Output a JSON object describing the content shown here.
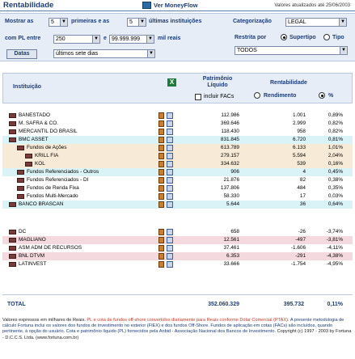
{
  "header": {
    "title": "Rentabilidade",
    "link": "Ver MoneyFlow",
    "updated": "Valores atualizados até 25/06/2003"
  },
  "filters": {
    "show_label": "Mostrar as",
    "first_value": "5",
    "first_label": "primeiras e as",
    "last_value": "5",
    "last_label": "últimas instituições",
    "category_label": "Categorização",
    "category_value": "LEGAL",
    "pl_label": "com PL entre",
    "pl_min": "250",
    "and_label": "e",
    "pl_max": "99.999.999",
    "thousands_label": "mil reais",
    "restrict_label": "Restrita por",
    "supertipo_label": "Supertipo",
    "tipo_label": "Tipo",
    "restrict_value": "TODOS",
    "dates_button": "Datas",
    "period_value": "últimos sete dias"
  },
  "table": {
    "col_institution": "Instituição",
    "col_patrimony": "Patrimônio Líquido",
    "include_facs": "incluir FACs",
    "col_return": "Rentabilidade",
    "col_yield": "Rendimento",
    "col_pct": "%",
    "rows": [
      {
        "name": "BANESTADO",
        "patrimony": "112.986",
        "yield": "1.001",
        "pct": "0,89%"
      },
      {
        "name": "M. SAFRA & CO.",
        "patrimony": "369.646",
        "yield": "2.999",
        "pct": "0,82%"
      },
      {
        "name": "MERCANTIL DO BRASIL",
        "patrimony": "118.430",
        "yield": "958",
        "pct": "0,82%"
      },
      {
        "name": "BMC ASSET",
        "patrimony": "831.845",
        "yield": "6.720",
        "pct": "0,81%"
      },
      {
        "name": "Fundos de Ações",
        "patrimony": "613.789",
        "yield": "6.133",
        "pct": "1,01%"
      },
      {
        "name": "KRILL FIA",
        "patrimony": "279.157",
        "yield": "5.594",
        "pct": "2,04%"
      },
      {
        "name": "KOL",
        "patrimony": "334.632",
        "yield": "539",
        "pct": "0,16%"
      },
      {
        "name": "Fundos Referenciados - Outros",
        "patrimony": "906",
        "yield": "4",
        "pct": "0,45%"
      },
      {
        "name": "Fundos Referenciados - DI",
        "patrimony": "21.876",
        "yield": "82",
        "pct": "0,38%"
      },
      {
        "name": "Fundos de Renda Fixa",
        "patrimony": "137.806",
        "yield": "484",
        "pct": "0,35%"
      },
      {
        "name": "Fundos Multi-Mercado",
        "patrimony": "58.330",
        "yield": "17",
        "pct": "0,03%"
      },
      {
        "name": "BANCO BRASCAN",
        "patrimony": "5.644",
        "yield": "36",
        "pct": "0,64%"
      },
      {
        "name": "DC",
        "patrimony": "658",
        "yield": "-26",
        "pct": "-3,74%"
      },
      {
        "name": "MAGLIANO",
        "patrimony": "12.561",
        "yield": "-497",
        "pct": "-3,81%"
      },
      {
        "name": "ASM ADM DE RECURSOS",
        "patrimony": "37.461",
        "yield": "-1.606",
        "pct": "-4,11%"
      },
      {
        "name": "BNL DTVM",
        "patrimony": "6.353",
        "yield": "-291",
        "pct": "-4,38%"
      },
      {
        "name": "LATINVEST",
        "patrimony": "33.666",
        "yield": "-1.754",
        "pct": "-4,95%"
      }
    ],
    "total_label": "TOTAL",
    "total_patrimony": "352.060.329",
    "total_yield": "395.732",
    "total_pct": "0,11%"
  },
  "footer": {
    "line1": "Valores expressos em milhares de Reais.",
    "line1_red": "PL e cota de fundos off-shore convertidos diariamente para Reais conforme Dólar Comercial (PTAX).",
    "line2": "A presente metodologia de cálculo Fortuna inclui os valores dos fundos de investimento no exterior (FIEX) e dos fundos Off-Shore. Fundos de aplicação em cotas (FACs) são incluídos, quando pertinente, à opção do usuário. Cota e patrimônio líquido (PL) fornecidos pela Anbid - Associação Nacional dos Bancos de Investimento.",
    "copyright": "Copyright (c) 1997 - 2003 by Fortuna - D.C.C.S. Ltda. (www.fortuna.com.br)"
  }
}
